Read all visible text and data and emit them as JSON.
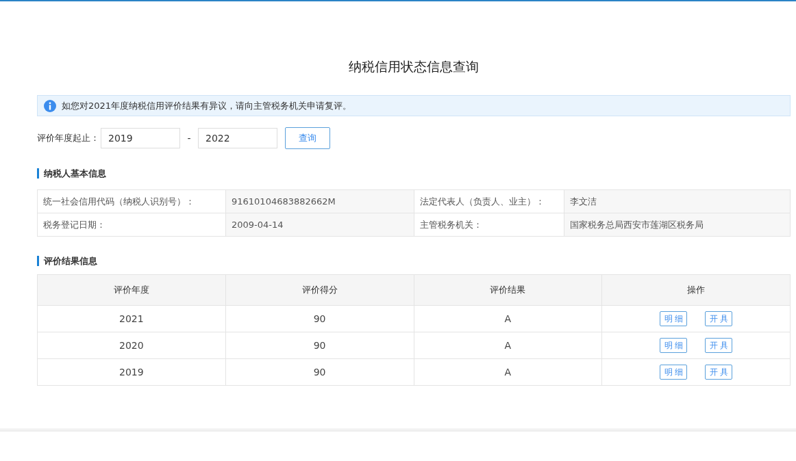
{
  "page_title": "纳税信用状态信息查询",
  "notice": {
    "text": "如您对2021年度纳税信用评价结果有异议，请向主管税务机关申请复评。"
  },
  "query": {
    "label": "评价年度起止：",
    "from": "2019",
    "separator": "-",
    "to": "2022",
    "button": "查询"
  },
  "basic_info": {
    "heading": "纳税人基本信息",
    "rows": [
      [
        {
          "label": "统一社会信用代码（纳税人识别号）：",
          "value": "91610104683882662M"
        },
        {
          "label": "法定代表人（负责人、业主）：",
          "value": "李文洁"
        }
      ],
      [
        {
          "label": "税务登记日期：",
          "value": "2009-04-14"
        },
        {
          "label": "主管税务机关：",
          "value": "国家税务总局西安市莲湖区税务局"
        }
      ]
    ]
  },
  "results": {
    "heading": "评价结果信息",
    "columns": [
      "评价年度",
      "评价得分",
      "评价结果",
      "操作"
    ],
    "rows": [
      {
        "year": "2021",
        "score": "90",
        "grade": "A",
        "actions": [
          "明细",
          "开具"
        ]
      },
      {
        "year": "2020",
        "score": "90",
        "grade": "A",
        "actions": [
          "明细",
          "开具"
        ]
      },
      {
        "year": "2019",
        "score": "90",
        "grade": "A",
        "actions": [
          "明细",
          "开具"
        ]
      }
    ]
  }
}
